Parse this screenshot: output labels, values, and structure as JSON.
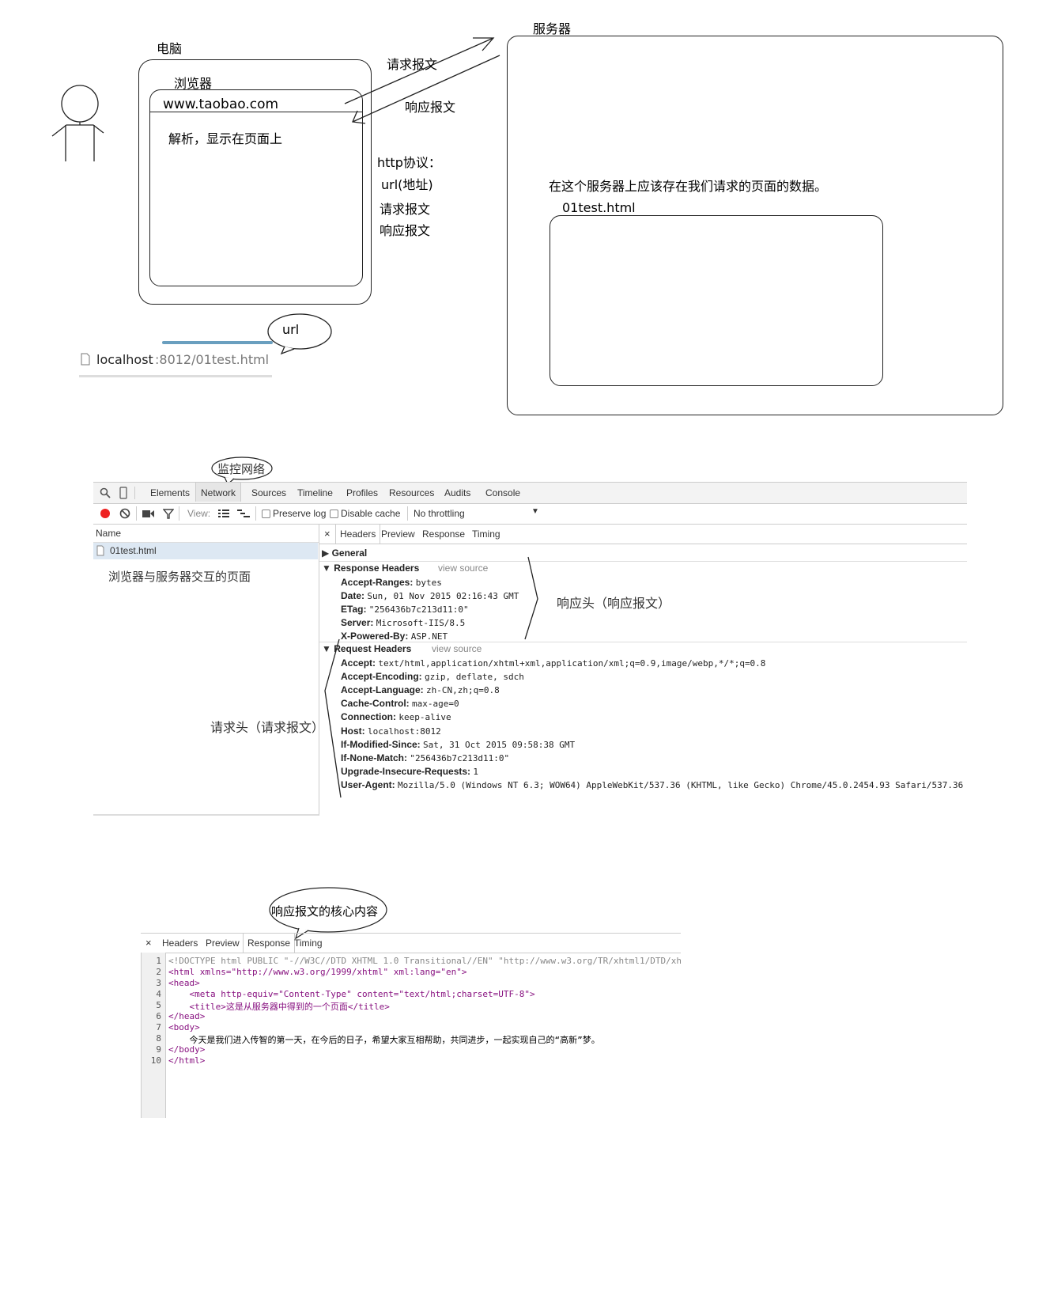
{
  "diagram": {
    "computer_label": "电脑",
    "browser_label": "浏览器",
    "browser_url": "www.taobao.com",
    "browser_content": "解析，显示在页面上",
    "request_label": "请求报文",
    "response_label": "响应报文",
    "protocol_lines": [
      "http协议：",
      "url(地址)",
      "请求报文",
      "响应报文"
    ],
    "server_label": "服务器",
    "server_note": "在这个服务器上应该存在我们请求的页面的数据。",
    "server_file": "01test.html",
    "url_bubble": "url",
    "address_bar": {
      "host": "localhost",
      "rest": ":8012/01test.html"
    }
  },
  "devtools": {
    "bubble": "监控网络",
    "tabs": [
      "Elements",
      "Network",
      "Sources",
      "Timeline",
      "Profiles",
      "Resources",
      "Audits",
      "Console"
    ],
    "toolbar": {
      "view_label": "View:",
      "preserve_log": "Preserve log",
      "disable_cache": "Disable cache",
      "throttle": "No throttling"
    },
    "name_header": "Name",
    "file": "01test.html",
    "file_note": "浏览器与服务器交互的页面",
    "detail_tabs": [
      "Headers",
      "Preview",
      "Response",
      "Timing"
    ],
    "general": "General",
    "response_headers_title": "Response Headers",
    "request_headers_title": "Request Headers",
    "view_source": "view source",
    "response_headers": [
      {
        "k": "Accept-Ranges:",
        "v": "bytes"
      },
      {
        "k": "Date:",
        "v": "Sun, 01 Nov 2015 02:16:43 GMT"
      },
      {
        "k": "ETag:",
        "v": "\"256436b7c213d11:0\""
      },
      {
        "k": "Server:",
        "v": "Microsoft-IIS/8.5"
      },
      {
        "k": "X-Powered-By:",
        "v": "ASP.NET"
      }
    ],
    "request_headers": [
      {
        "k": "Accept:",
        "v": "text/html,application/xhtml+xml,application/xml;q=0.9,image/webp,*/*;q=0.8"
      },
      {
        "k": "Accept-Encoding:",
        "v": "gzip, deflate, sdch"
      },
      {
        "k": "Accept-Language:",
        "v": "zh-CN,zh;q=0.8"
      },
      {
        "k": "Cache-Control:",
        "v": "max-age=0"
      },
      {
        "k": "Connection:",
        "v": "keep-alive"
      },
      {
        "k": "Host:",
        "v": "localhost:8012"
      },
      {
        "k": "If-Modified-Since:",
        "v": "Sat, 31 Oct 2015 09:58:38 GMT"
      },
      {
        "k": "If-None-Match:",
        "v": "\"256436b7c213d11:0\""
      },
      {
        "k": "Upgrade-Insecure-Requests:",
        "v": "1"
      },
      {
        "k": "User-Agent:",
        "v": "Mozilla/5.0 (Windows NT 6.3; WOW64) AppleWebKit/537.36 (KHTML, like Gecko) Chrome/45.0.2454.93 Safari/537.36"
      }
    ],
    "response_note": "响应头（响应报文）",
    "request_note": "请求头（请求报文）"
  },
  "response_panel": {
    "bubble": "响应报文的核心内容",
    "tabs": [
      "Headers",
      "Preview",
      "Response",
      "Timing"
    ],
    "code": [
      "<!DOCTYPE html PUBLIC \"-//W3C//DTD XHTML 1.0 Transitional//EN\" \"http://www.w3.org/TR/xhtml1/DTD/xh",
      "<html xmlns=\"http://www.w3.org/1999/xhtml\" xml:lang=\"en\">",
      "<head>",
      "    <meta http-equiv=\"Content-Type\" content=\"text/html;charset=UTF-8\">",
      "    <title>这是从服务器中得到的一个页面</title>",
      "</head>",
      "<body>",
      "    今天是我们进入传智的第一天，在今后的日子，希望大家互相帮助，共同进步，一起实现自己的“高新”梦。",
      "</body>",
      "</html>"
    ]
  }
}
